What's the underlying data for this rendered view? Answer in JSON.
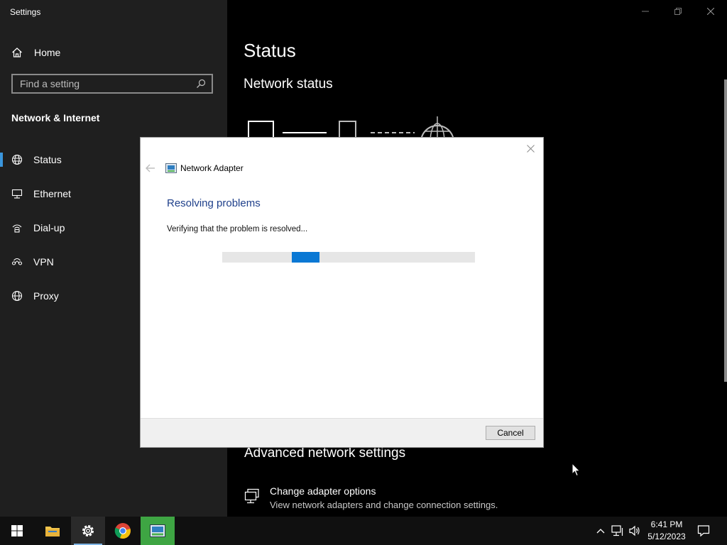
{
  "window": {
    "title": "Settings"
  },
  "sidebar": {
    "home_label": "Home",
    "search_placeholder": "Find a setting",
    "section_title": "Network & Internet",
    "items": [
      {
        "label": "Status",
        "icon": "globe-icon",
        "selected": true
      },
      {
        "label": "Ethernet",
        "icon": "ethernet-icon",
        "selected": false
      },
      {
        "label": "Dial-up",
        "icon": "dial-up-icon",
        "selected": false
      },
      {
        "label": "VPN",
        "icon": "vpn-icon",
        "selected": false
      },
      {
        "label": "Proxy",
        "icon": "proxy-globe-icon",
        "selected": false
      }
    ]
  },
  "main": {
    "title": "Status",
    "network_status_title": "Network status",
    "advanced_title": "Advanced network settings",
    "adapter_option": {
      "title": "Change adapter options",
      "description": "View network adapters and change connection settings."
    }
  },
  "dialog": {
    "app_name": "Network Adapter",
    "heading": "Resolving problems",
    "status": "Verifying that the problem is resolved...",
    "progress_state": "indeterminate",
    "cancel_label": "Cancel"
  },
  "taskbar": {
    "apps": [
      "start-icon",
      "file-explorer-icon",
      "settings-gear-icon",
      "chrome-icon",
      "troubleshooter-icon"
    ],
    "tray": [
      "chevron-up-icon",
      "network-icon",
      "volume-icon"
    ],
    "time": "6:41 PM",
    "date": "5/12/2023",
    "notification_icon": "action-center-icon"
  },
  "colors": {
    "accent": "#0a78d4",
    "selection_bar": "#3a96dd",
    "dialog_heading": "#1e3f8a",
    "taskbar_highlight": "#3ea543"
  }
}
